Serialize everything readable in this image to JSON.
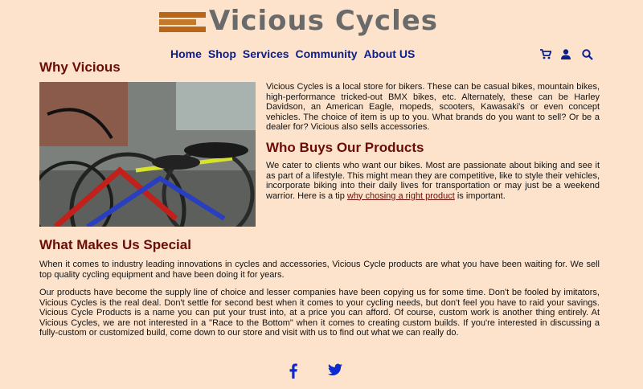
{
  "brand": {
    "name": "Vicious  Cycles",
    "colors": {
      "accent": "#b8661a",
      "nav": "#0b1e8a",
      "heading": "#6b0d06",
      "background": "#fde3cc"
    }
  },
  "nav": {
    "items": [
      "Home",
      "Shop",
      "Services",
      "Community",
      "About US"
    ],
    "icons": [
      "cart-icon",
      "user-icon",
      "search-icon"
    ]
  },
  "why": {
    "heading": "Why Vicious",
    "text": "Vicious Cycles is a local store for bikers. These can be casual bikes, mountain bikes, high-performance tricked-out BMX bikes, etc. Alternately, these can be Harley Davidson, an American Eagle, mopeds, scooters, Kawasaki's or even concept vehicles. The choice of item is up to you. What brands do you want to sell? Or be a dealer for? Vicious also sells accessories."
  },
  "who": {
    "heading": "Who Buys Our Products",
    "text_before_link": "We cater to clients who want our bikes. Most are passionate about biking and see it as part of a lifestyle. This might mean they are competitive, like to style their vehicles, incorporate biking into their daily lives for transportation or may just be a weekend warrior. Here is a tip ",
    "link": "why chosing a right product",
    "text_after_link": " is important."
  },
  "special": {
    "heading": "What Makes Us Special",
    "p1": "When it comes to industry leading innovations in cycles and accessories, Vicious Cycle products are what you have been waiting for. We sell top quality cycling equipment and have been doing it for years.",
    "p2": "Our products have become the supply line of choice and lesser companies have been copying us for some time. Don't be fooled by imitators, Vicious Cycles is the real deal. Don't settle for second best when it comes to your cycling needs, but don't feel you have to raid your savings. Vicious Cycle Products is a name you can put your trust into, at a price you can afford. Of course, custom work is another thing entirely. At Vicious Cycles, we are not interested in a \"Race to the Bottom\" when it comes to creating custom builds. If you're interested in discussing a fully-custom or customized build, come down to our store and visit with us to find out what we can really do."
  },
  "social": [
    "facebook-icon",
    "twitter-icon"
  ]
}
